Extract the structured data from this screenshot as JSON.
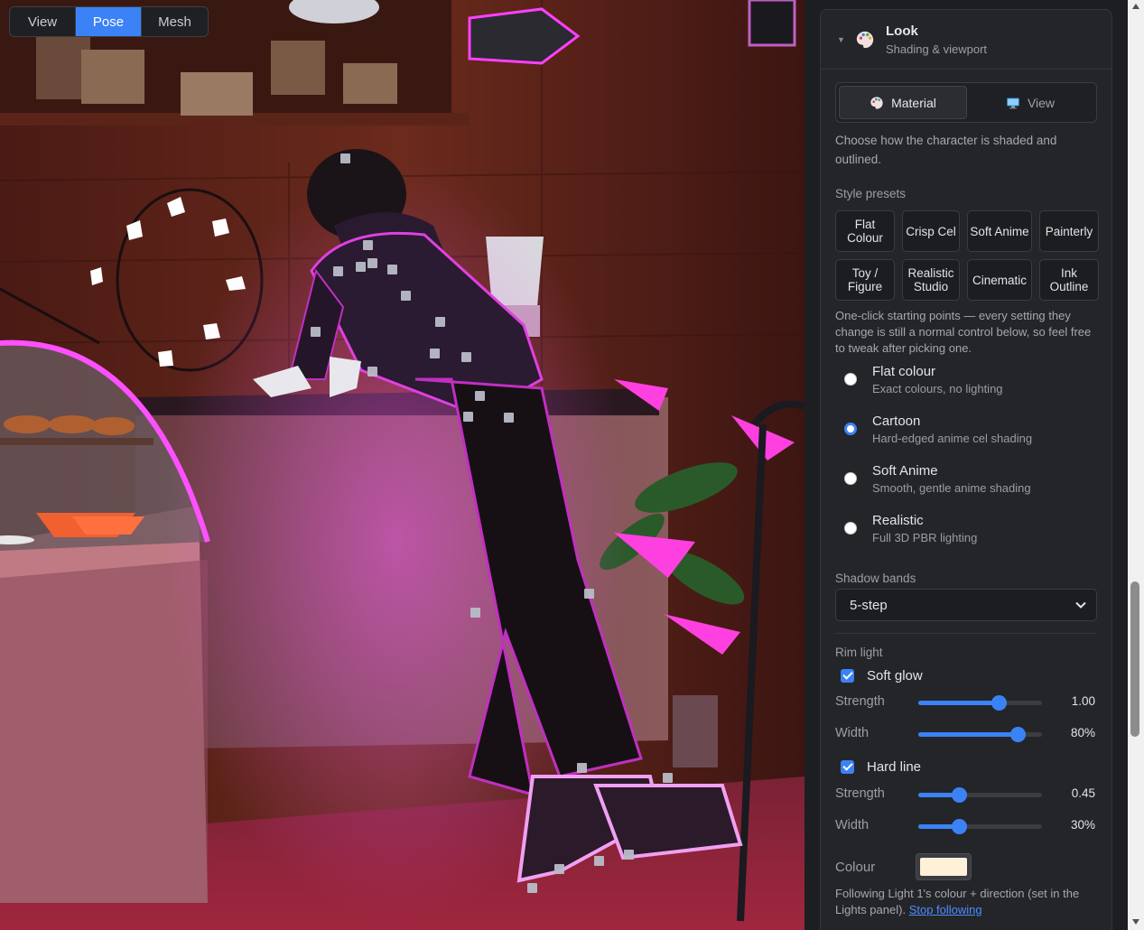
{
  "viewport": {
    "mode_tabs": [
      {
        "label": "View",
        "active": false
      },
      {
        "label": "Pose",
        "active": true
      },
      {
        "label": "Mesh",
        "active": false
      }
    ]
  },
  "panel": {
    "header": {
      "icon": "palette-icon",
      "title": "Look",
      "subtitle": "Shading & viewport"
    },
    "subtabs": [
      {
        "label": "Material",
        "icon": "palette-icon",
        "active": true
      },
      {
        "label": "View",
        "icon": "monitor-icon",
        "active": false
      }
    ],
    "description": "Choose how the character is shaded and outlined.",
    "style_presets": {
      "label": "Style presets",
      "items": [
        "Flat Colour",
        "Crisp Cel",
        "Soft Anime",
        "Painterly",
        "Toy / Figure",
        "Realistic Studio",
        "Cinematic",
        "Ink Outline"
      ],
      "hint": "One-click starting points — every setting they change is still a normal control below, so feel free to tweak after picking one."
    },
    "shading_modes": [
      {
        "title": "Flat colour",
        "subtitle": "Exact colours, no lighting",
        "checked": false
      },
      {
        "title": "Cartoon",
        "subtitle": "Hard-edged anime cel shading",
        "checked": true
      },
      {
        "title": "Soft Anime",
        "subtitle": "Smooth, gentle anime shading",
        "checked": false
      },
      {
        "title": "Realistic",
        "subtitle": "Full 3D PBR lighting",
        "checked": false
      }
    ],
    "shadow_bands": {
      "label": "Shadow bands",
      "value": "5-step"
    },
    "rim_light": {
      "label": "Rim light",
      "soft_glow": {
        "label": "Soft glow",
        "checked": true,
        "strength": {
          "label": "Strength",
          "value": "1.00",
          "fraction": 0.65
        },
        "width": {
          "label": "Width",
          "value": "80%",
          "fraction": 0.8
        }
      },
      "hard_line": {
        "label": "Hard line",
        "checked": true,
        "strength": {
          "label": "Strength",
          "value": "0.45",
          "fraction": 0.33
        },
        "width": {
          "label": "Width",
          "value": "30%",
          "fraction": 0.33
        }
      },
      "colour": {
        "label": "Colour",
        "value": "#fff0d8"
      },
      "note_prefix": "Following Light 1's colour + direction (set in the Lights panel).",
      "note_link": "Stop following"
    }
  },
  "colors": {
    "accent": "#3b82f6",
    "panel_bg": "#242529",
    "rim_magenta": "#e040e0"
  }
}
